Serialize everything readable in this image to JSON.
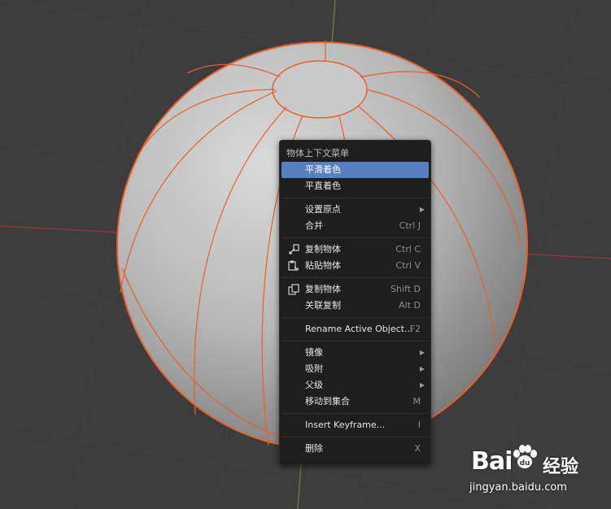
{
  "viewport": {
    "background": "#3d3d3d",
    "selection_color": "#e8602c",
    "x_axis_color": "#9a3a3a",
    "y_axis_color": "#6d8a2f"
  },
  "context_menu": {
    "title": "物体上下文菜单",
    "items": [
      {
        "label": "平滑着色",
        "shortcut": "",
        "submenu": false,
        "icon": "",
        "active": true
      },
      {
        "label": "平直着色",
        "shortcut": "",
        "submenu": false,
        "icon": "",
        "active": false
      },
      {
        "label": "设置原点",
        "shortcut": "",
        "submenu": true,
        "icon": "",
        "active": false
      },
      {
        "label": "合并",
        "shortcut": "Ctrl J",
        "submenu": false,
        "icon": "",
        "active": false
      },
      {
        "label": "复制物体",
        "shortcut": "Ctrl C",
        "submenu": false,
        "icon": "copy-icon",
        "active": false
      },
      {
        "label": "粘贴物体",
        "shortcut": "Ctrl V",
        "submenu": false,
        "icon": "paste-icon",
        "active": false
      },
      {
        "label": "复制物体",
        "shortcut": "Shift D",
        "submenu": false,
        "icon": "duplicate-icon",
        "active": false
      },
      {
        "label": "关联复制",
        "shortcut": "Alt D",
        "submenu": false,
        "icon": "",
        "active": false
      },
      {
        "label": "Rename Active Object...",
        "shortcut": "F2",
        "submenu": false,
        "icon": "",
        "active": false
      },
      {
        "label": "镜像",
        "shortcut": "",
        "submenu": true,
        "icon": "",
        "active": false
      },
      {
        "label": "吸附",
        "shortcut": "",
        "submenu": true,
        "icon": "",
        "active": false
      },
      {
        "label": "父级",
        "shortcut": "",
        "submenu": true,
        "icon": "",
        "active": false
      },
      {
        "label": "移动到集合",
        "shortcut": "M",
        "submenu": false,
        "icon": "",
        "active": false
      },
      {
        "label": "Insert Keyframe...",
        "shortcut": "I",
        "submenu": false,
        "icon": "",
        "active": false
      },
      {
        "label": "删除",
        "shortcut": "X",
        "submenu": false,
        "icon": "",
        "active": false
      }
    ]
  },
  "watermark": {
    "logo_text": "Bai",
    "brand_text": "经验",
    "url": "jingyan.baidu.com"
  }
}
